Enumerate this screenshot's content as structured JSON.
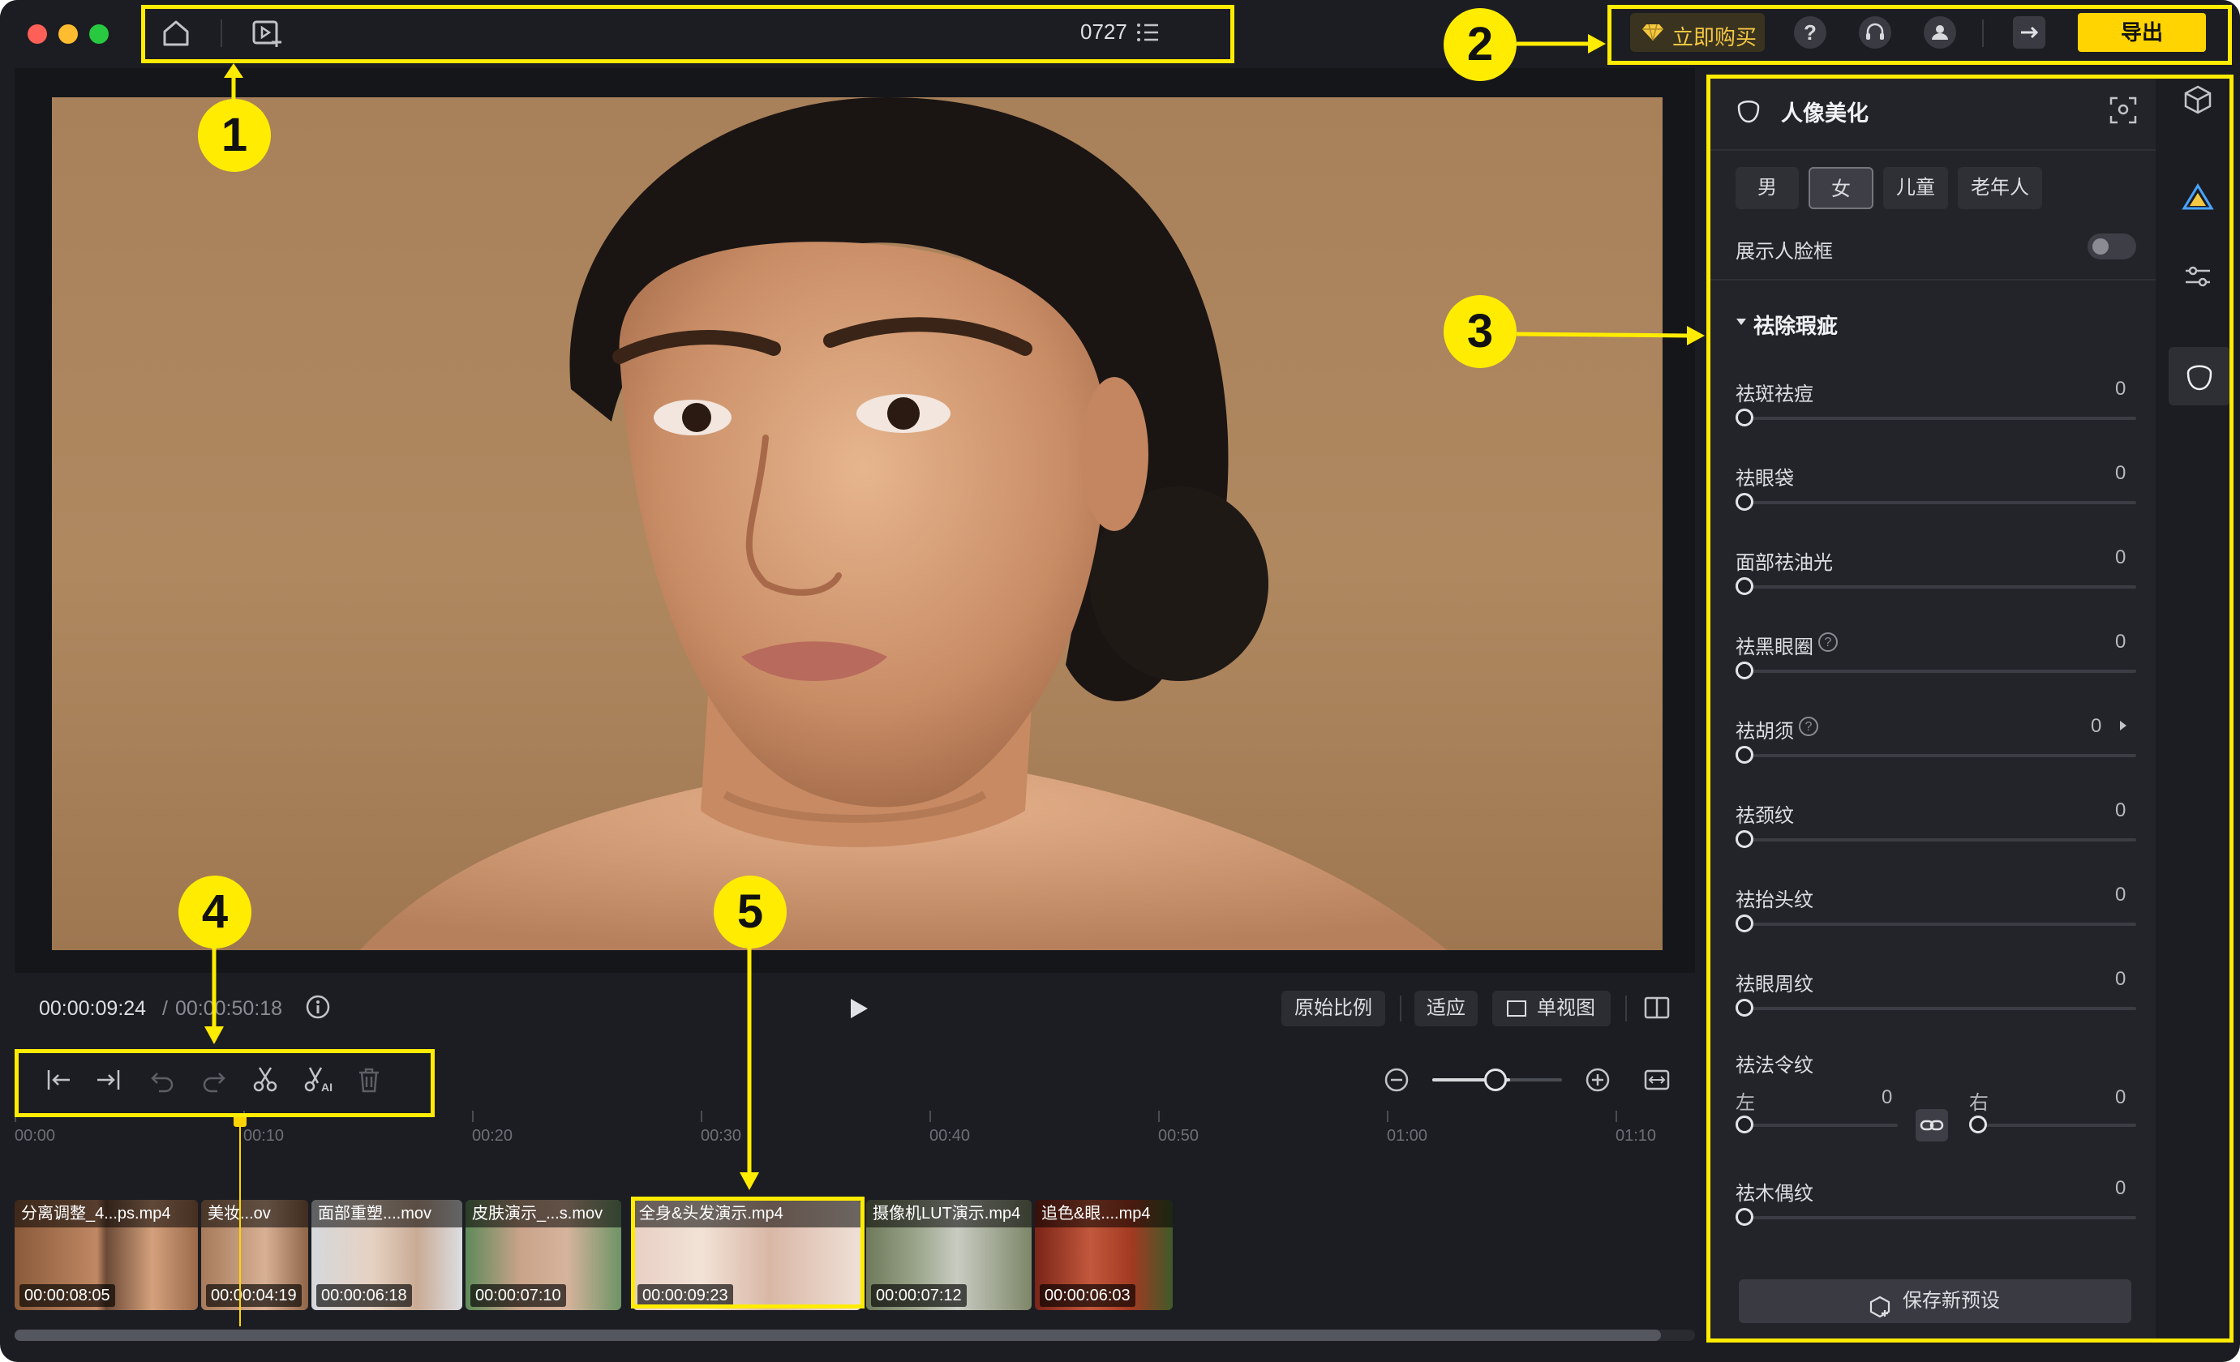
{
  "titlebar": {
    "project_name": "0727",
    "buy_label": "立即购买",
    "export_label": "导出"
  },
  "player": {
    "current_time": "00:00:09:24",
    "separator": "/",
    "total_time": "00:00:50:18",
    "ratio_label": "原始比例",
    "fit_label": "适应",
    "single_view_label": "单视图"
  },
  "panel": {
    "title": "人像美化",
    "gender_tabs": [
      {
        "label": "男"
      },
      {
        "label": "女"
      },
      {
        "label": "儿童"
      },
      {
        "label": "老年人"
      }
    ],
    "show_face_frame_label": "展示人脸框",
    "section_title": "祛除瑕疵",
    "sliders": [
      {
        "label": "祛斑祛痘",
        "value": "0"
      },
      {
        "label": "祛眼袋",
        "value": "0"
      },
      {
        "label": "面部祛油光",
        "value": "0"
      },
      {
        "label": "祛黑眼圈",
        "value": "0"
      },
      {
        "label": "祛胡须",
        "value": "0"
      },
      {
        "label": "祛颈纹",
        "value": "0"
      },
      {
        "label": "祛抬头纹",
        "value": "0"
      },
      {
        "label": "祛眼周纹",
        "value": "0"
      }
    ],
    "nasolabial": {
      "label": "祛法令纹",
      "left_label": "左",
      "left_value": "0",
      "right_label": "右",
      "right_value": "0"
    },
    "marionette": {
      "label": "祛木偶纹",
      "value": "0"
    },
    "save_preset_label": "保存新预设"
  },
  "timeline": {
    "ticks": [
      "00:00",
      "00:10",
      "00:20",
      "00:30",
      "00:40",
      "00:50",
      "01:00",
      "01:10"
    ],
    "zoom_level": 0.6,
    "clips": [
      {
        "name": "分离调整_4...ps.mp4",
        "duration": "00:00:08:05"
      },
      {
        "name": "美妆...ov",
        "duration": "00:00:04:19"
      },
      {
        "name": "面部重塑....mov",
        "duration": "00:00:06:18"
      },
      {
        "name": "皮肤演示_...s.mov",
        "duration": "00:00:07:10"
      },
      {
        "name": "全身&头发演示.mp4",
        "duration": "00:00:09:23"
      },
      {
        "name": "摄像机LUT演示.mp4",
        "duration": "00:00:07:12"
      },
      {
        "name": "追色&眼....mp4",
        "duration": "00:00:06:03"
      }
    ]
  },
  "callouts": {
    "n1": "1",
    "n2": "2",
    "n3": "3",
    "n4": "4",
    "n5": "5"
  },
  "colors": {
    "accent": "#ffd400",
    "highlight": "#ffec00",
    "background": "#1c1d22",
    "panel": "#232429"
  }
}
